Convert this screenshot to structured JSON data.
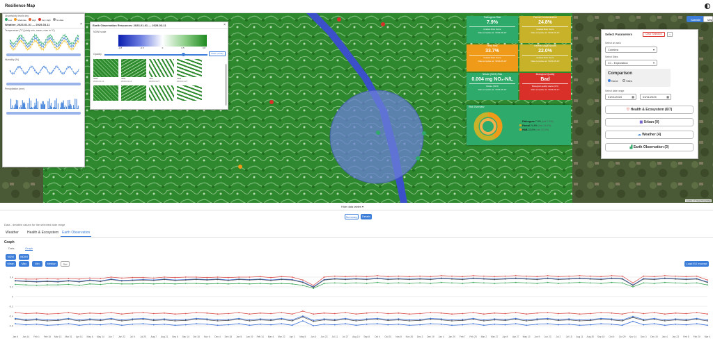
{
  "app": {
    "title": "Resilience Map"
  },
  "map_controls": {
    "btn1": "Satellite",
    "btn2": "Map"
  },
  "attribution": "Leaflet | © OpenStreetMap",
  "weather": {
    "header": "Uncertainty levels key:",
    "legend": [
      "Low",
      "Moderate",
      "High",
      "Very High",
      "No data"
    ],
    "title": "Weather, 2023-01-01 — 2025-03-11",
    "chart1_title": "Temperature (°C) (daily min, mean, max in ºC)",
    "chart1_legend": [
      "Min",
      "Mean",
      "Max"
    ],
    "chart2_title": "Humidity (%)",
    "chart2_legend": [
      "Humidity"
    ],
    "chart3_title": "Precipitation (mm)",
    "chart3_legend": [
      "Precipitation"
    ],
    "x_ticks": [
      "2023-01-30",
      "2023-06-01",
      "2024-01-20",
      "2024-06-22",
      "2025-01-30"
    ]
  },
  "eo": {
    "title": "Earth Observation Resources: 2023-01-01 — 2025-03-11",
    "scale_label": "NDWI scale",
    "scale_ticks": [
      "-0.8",
      "-0.5",
      "0",
      "0.5",
      "0.8"
    ],
    "opacity_label": "Opacity",
    "clear_btn": "Clear overlay",
    "thumbs": [
      {
        "name": "ndwi",
        "date": "2023-01-13"
      },
      {
        "name": "ndwi",
        "date": "2023-01-14"
      },
      {
        "name": "ndvi",
        "date": "2023-01-27"
      },
      {
        "name": "ndwi",
        "date": "2023-01-27"
      }
    ]
  },
  "cards": [
    {
      "title": "Pathogens Risk",
      "value": "7.9%",
      "sub1": "Graded Risk Score",
      "sub2": "Data complete at: '2023-06-19'",
      "color": "#2eaa6a"
    },
    {
      "title": "Faecal Contamination",
      "value": "24.8%",
      "sub1": "Graded Risk Score",
      "sub2": "Data complete at: '2023-06-19'",
      "color": "#c7b22a"
    },
    {
      "title": "Heat Risk",
      "value": "33.7%",
      "sub1": "Graded Risk Score",
      "sub2": "Data complete at: '2023-06-19'",
      "color": "#f09a1a"
    },
    {
      "title": "Harmful Algal Bloom",
      "value": "22.0%",
      "sub1": "Graded Risk Score",
      "sub2": "Data complete at: '2023-06-19'",
      "color": "#c7b22a"
    },
    {
      "title": "Nitrate (NO3) Risk",
      "value": "0.004 mg NO₃-N/L",
      "sub1": "Nitrate (NO3)",
      "sub2": "Data complete at: '2023-06-19'",
      "color": "#2eaa6a"
    },
    {
      "title": "Biological Quality",
      "value": "Bad",
      "sub1": "Biological quality status (CV)",
      "sub2": "Data complete at: '2023-06-17'",
      "color": "#d9302a"
    }
  ],
  "risk_overview": {
    "title": "Risk Overview",
    "items": [
      {
        "name": "Pathogens",
        "value": "7.9%",
        "extra": "(risk 7.9%)",
        "color": "#2eaa6a"
      },
      {
        "name": "Faecal",
        "value": "24.8%",
        "extra": "(risk 24.8%)",
        "color": "#c7b22a"
      },
      {
        "name": "HAB",
        "value": "22.0%",
        "extra": "(risk 22.0%)",
        "color": "#f09a1a"
      }
    ]
  },
  "params": {
    "title": "Select Parameters",
    "reset_btn": "Clear Selection",
    "area_label": "Select an area",
    "area_value": "Coimbra",
    "sites_label": "Select Sites",
    "sites_value": "C1 - Exploration",
    "comparison_title": "Comparison",
    "radio_none": "None",
    "radio_sites": "Sites",
    "date_label": "Select date range",
    "date_start": "01/01/2023",
    "date_end": "03/11/2025",
    "accordions": [
      "Health & Ecosystem (6/7)",
      "Urban (0)",
      "Weather (4)",
      "Earth Observation (3)"
    ]
  },
  "bottom": {
    "hide_toggle": "Hide data tables",
    "summary_btn": "Summary",
    "details_btn": "Details",
    "caption": "Data - detailed values for the selected date range",
    "tabs": [
      "Weather",
      "Health & Ecosystem",
      "Earth Observation"
    ],
    "graph_label": "Graph",
    "subtabs": [
      "Data",
      "Graph"
    ],
    "index_btns": [
      "NDVI",
      "NDWI"
    ],
    "stat_btns": [
      "Mean",
      "Max",
      "Min",
      "Median",
      "Std"
    ],
    "load_btn": "Load EO excerpt"
  },
  "chart_data": {
    "type": "line",
    "title": "",
    "xlabel": "",
    "ylabel": "",
    "ylim": [
      -0.7,
      0.5
    ],
    "y_ticks": [
      "0.4",
      "0.2",
      "0",
      "-0.2",
      "-0.4",
      "-0.6"
    ],
    "x_ticks": [
      "Jan 6",
      "Jan 14",
      "Feb 1",
      "Feb 15",
      "Mar 13",
      "Mar 31",
      "Apr 14",
      "May 6",
      "May 14",
      "Jun 7",
      "Jun 22",
      "Jul 6",
      "Jul 20",
      "Aug 7",
      "Aug 21",
      "Sep 6",
      "Sep 14",
      "Oct 18",
      "Nov 6",
      "Dec 4",
      "Dec 18",
      "Jan 5",
      "Jan 19",
      "Feb 14",
      "Mar 4",
      "Mar 22",
      "Apr 3",
      "May 5",
      "Jun 4",
      "Jun 23",
      "Jul 11",
      "Jul 27",
      "Aug 10",
      "Sep 8",
      "Oct 4",
      "Oct 20",
      "Nov 8",
      "Nov 26",
      "Dec 3",
      "Dec 19",
      "Jan 4",
      "Jan 20",
      "Feb 7",
      "Feb 25",
      "Mar 2",
      "Mar 27",
      "Apr 8",
      "Apr 27",
      "May 13",
      "Jun 9",
      "Jun 23",
      "Jul 2",
      "Jul 15",
      "Aug 11",
      "Aug 30",
      "Sep 18",
      "Oct 6",
      "Oct 29",
      "Nov 14",
      "Dec 3",
      "Dec 19",
      "Jan 4",
      "Jan 23",
      "Feb 5",
      "Feb 20",
      "Mar 4"
    ],
    "series": [
      {
        "name": "NDVI mean",
        "color": "#3a6fd8",
        "values": [
          0.33,
          0.32,
          0.31,
          0.32,
          0.31,
          0.33,
          0.31,
          0.34,
          0.32,
          0.36,
          0.33,
          0.34,
          0.35,
          0.34,
          0.36,
          0.34,
          0.35,
          0.36,
          0.35,
          0.36,
          0.34,
          0.36,
          0.35,
          0.36,
          0.34,
          0.36,
          0.35,
          0.3,
          0.2,
          0.35,
          0.37,
          0.36,
          0.37,
          0.36,
          0.38,
          0.36,
          0.37,
          0.36,
          0.37,
          0.36,
          0.38,
          0.37,
          0.36,
          0.38,
          0.37,
          0.36,
          0.37,
          0.38,
          0.37,
          0.36,
          0.38,
          0.36,
          0.37,
          0.38,
          0.37,
          0.36,
          0.38,
          0.37,
          0.24,
          0.37,
          0.36,
          0.38,
          0.37,
          0.36,
          0.37,
          0.3
        ]
      },
      {
        "name": "NDVI max",
        "color": "#d9534f",
        "values": [
          0.37,
          0.36,
          0.36,
          0.37,
          0.36,
          0.37,
          0.36,
          0.38,
          0.37,
          0.4,
          0.38,
          0.39,
          0.39,
          0.38,
          0.4,
          0.39,
          0.4,
          0.4,
          0.39,
          0.4,
          0.39,
          0.4,
          0.4,
          0.41,
          0.39,
          0.41,
          0.4,
          0.34,
          0.23,
          0.4,
          0.42,
          0.41,
          0.42,
          0.41,
          0.43,
          0.41,
          0.42,
          0.41,
          0.42,
          0.41,
          0.43,
          0.42,
          0.41,
          0.43,
          0.42,
          0.41,
          0.42,
          0.43,
          0.42,
          0.41,
          0.43,
          0.41,
          0.42,
          0.43,
          0.42,
          0.41,
          0.43,
          0.42,
          0.28,
          0.42,
          0.41,
          0.43,
          0.42,
          0.41,
          0.42,
          0.34
        ]
      },
      {
        "name": "NDVI median",
        "color": "#555555",
        "values": [
          0.32,
          0.31,
          0.3,
          0.31,
          0.3,
          0.32,
          0.3,
          0.33,
          0.31,
          0.35,
          0.32,
          0.33,
          0.34,
          0.33,
          0.35,
          0.33,
          0.34,
          0.35,
          0.34,
          0.35,
          0.33,
          0.35,
          0.34,
          0.35,
          0.33,
          0.35,
          0.34,
          0.29,
          0.19,
          0.34,
          0.36,
          0.35,
          0.36,
          0.35,
          0.37,
          0.35,
          0.36,
          0.35,
          0.36,
          0.35,
          0.37,
          0.36,
          0.35,
          0.37,
          0.36,
          0.35,
          0.36,
          0.37,
          0.36,
          0.35,
          0.37,
          0.35,
          0.36,
          0.37,
          0.36,
          0.35,
          0.37,
          0.36,
          0.23,
          0.36,
          0.35,
          0.37,
          0.36,
          0.35,
          0.36,
          0.29
        ]
      },
      {
        "name": "NDVI std",
        "color": "#3aa757",
        "values": [
          0.25,
          0.24,
          0.23,
          0.24,
          0.24,
          0.25,
          0.23,
          0.26,
          0.25,
          0.27,
          0.26,
          0.26,
          0.27,
          0.26,
          0.27,
          0.26,
          0.27,
          0.27,
          0.26,
          0.27,
          0.26,
          0.27,
          0.26,
          0.27,
          0.26,
          0.27,
          0.26,
          0.23,
          0.17,
          0.27,
          0.28,
          0.27,
          0.28,
          0.27,
          0.29,
          0.27,
          0.28,
          0.27,
          0.28,
          0.27,
          0.29,
          0.28,
          0.27,
          0.29,
          0.28,
          0.27,
          0.28,
          0.29,
          0.28,
          0.27,
          0.29,
          0.27,
          0.28,
          0.29,
          0.28,
          0.27,
          0.29,
          0.28,
          0.2,
          0.28,
          0.27,
          0.29,
          0.28,
          0.27,
          0.28,
          0.24
        ]
      },
      {
        "name": "NDWI max",
        "color": "#d9534f",
        "values": [
          -0.33,
          -0.35,
          -0.34,
          -0.36,
          -0.35,
          -0.33,
          -0.36,
          -0.34,
          -0.35,
          -0.33,
          -0.36,
          -0.34,
          -0.33,
          -0.35,
          -0.34,
          -0.36,
          -0.35,
          -0.33,
          -0.34,
          -0.36,
          -0.35,
          -0.33,
          -0.36,
          -0.34,
          -0.35,
          -0.33,
          -0.36,
          -0.3,
          -0.36,
          -0.34,
          -0.35,
          -0.33,
          -0.36,
          -0.34,
          -0.33,
          -0.35,
          -0.34,
          -0.36,
          -0.35,
          -0.33,
          -0.34,
          -0.36,
          -0.35,
          -0.33,
          -0.36,
          -0.34,
          -0.35,
          -0.33,
          -0.36,
          -0.34,
          -0.33,
          -0.35,
          -0.34,
          -0.36,
          -0.35,
          -0.33,
          -0.34,
          -0.36,
          -0.32,
          -0.35,
          -0.33,
          -0.36,
          -0.34,
          -0.35,
          -0.33,
          -0.36
        ]
      },
      {
        "name": "NDWI mean",
        "color": "#3a6fd8",
        "values": [
          -0.45,
          -0.47,
          -0.46,
          -0.48,
          -0.47,
          -0.45,
          -0.48,
          -0.46,
          -0.47,
          -0.45,
          -0.48,
          -0.46,
          -0.45,
          -0.47,
          -0.46,
          -0.48,
          -0.47,
          -0.45,
          -0.46,
          -0.48,
          -0.47,
          -0.45,
          -0.48,
          -0.46,
          -0.47,
          -0.45,
          -0.48,
          -0.4,
          -0.49,
          -0.46,
          -0.47,
          -0.45,
          -0.48,
          -0.46,
          -0.45,
          -0.47,
          -0.46,
          -0.48,
          -0.47,
          -0.45,
          -0.46,
          -0.48,
          -0.47,
          -0.45,
          -0.48,
          -0.46,
          -0.47,
          -0.45,
          -0.48,
          -0.46,
          -0.45,
          -0.47,
          -0.46,
          -0.48,
          -0.47,
          -0.45,
          -0.46,
          -0.48,
          -0.41,
          -0.47,
          -0.45,
          -0.48,
          -0.46,
          -0.47,
          -0.45,
          -0.48
        ]
      },
      {
        "name": "NDWI median",
        "color": "#555555",
        "values": [
          -0.47,
          -0.49,
          -0.48,
          -0.5,
          -0.49,
          -0.47,
          -0.5,
          -0.48,
          -0.49,
          -0.47,
          -0.5,
          -0.48,
          -0.47,
          -0.49,
          -0.48,
          -0.5,
          -0.49,
          -0.47,
          -0.48,
          -0.5,
          -0.49,
          -0.47,
          -0.5,
          -0.48,
          -0.49,
          -0.47,
          -0.5,
          -0.42,
          -0.51,
          -0.48,
          -0.49,
          -0.47,
          -0.5,
          -0.48,
          -0.47,
          -0.49,
          -0.48,
          -0.5,
          -0.49,
          -0.47,
          -0.48,
          -0.5,
          -0.49,
          -0.47,
          -0.5,
          -0.48,
          -0.49,
          -0.47,
          -0.5,
          -0.48,
          -0.47,
          -0.49,
          -0.48,
          -0.5,
          -0.49,
          -0.47,
          -0.48,
          -0.5,
          -0.43,
          -0.49,
          -0.47,
          -0.5,
          -0.48,
          -0.49,
          -0.47,
          -0.5
        ]
      },
      {
        "name": "NDWI min",
        "color": "#3a6fd8",
        "values": [
          -0.56,
          -0.58,
          -0.57,
          -0.59,
          -0.58,
          -0.56,
          -0.59,
          -0.57,
          -0.58,
          -0.56,
          -0.59,
          -0.57,
          -0.56,
          -0.58,
          -0.57,
          -0.59,
          -0.58,
          -0.56,
          -0.57,
          -0.59,
          -0.58,
          -0.56,
          -0.59,
          -0.57,
          -0.58,
          -0.56,
          -0.59,
          -0.5,
          -0.6,
          -0.57,
          -0.58,
          -0.56,
          -0.59,
          -0.57,
          -0.56,
          -0.58,
          -0.57,
          -0.59,
          -0.58,
          -0.56,
          -0.57,
          -0.59,
          -0.58,
          -0.56,
          -0.59,
          -0.57,
          -0.58,
          -0.56,
          -0.59,
          -0.57,
          -0.56,
          -0.58,
          -0.57,
          -0.59,
          -0.58,
          -0.56,
          -0.57,
          -0.59,
          -0.51,
          -0.58,
          -0.56,
          -0.59,
          -0.57,
          -0.58,
          -0.56,
          -0.59
        ]
      }
    ]
  }
}
